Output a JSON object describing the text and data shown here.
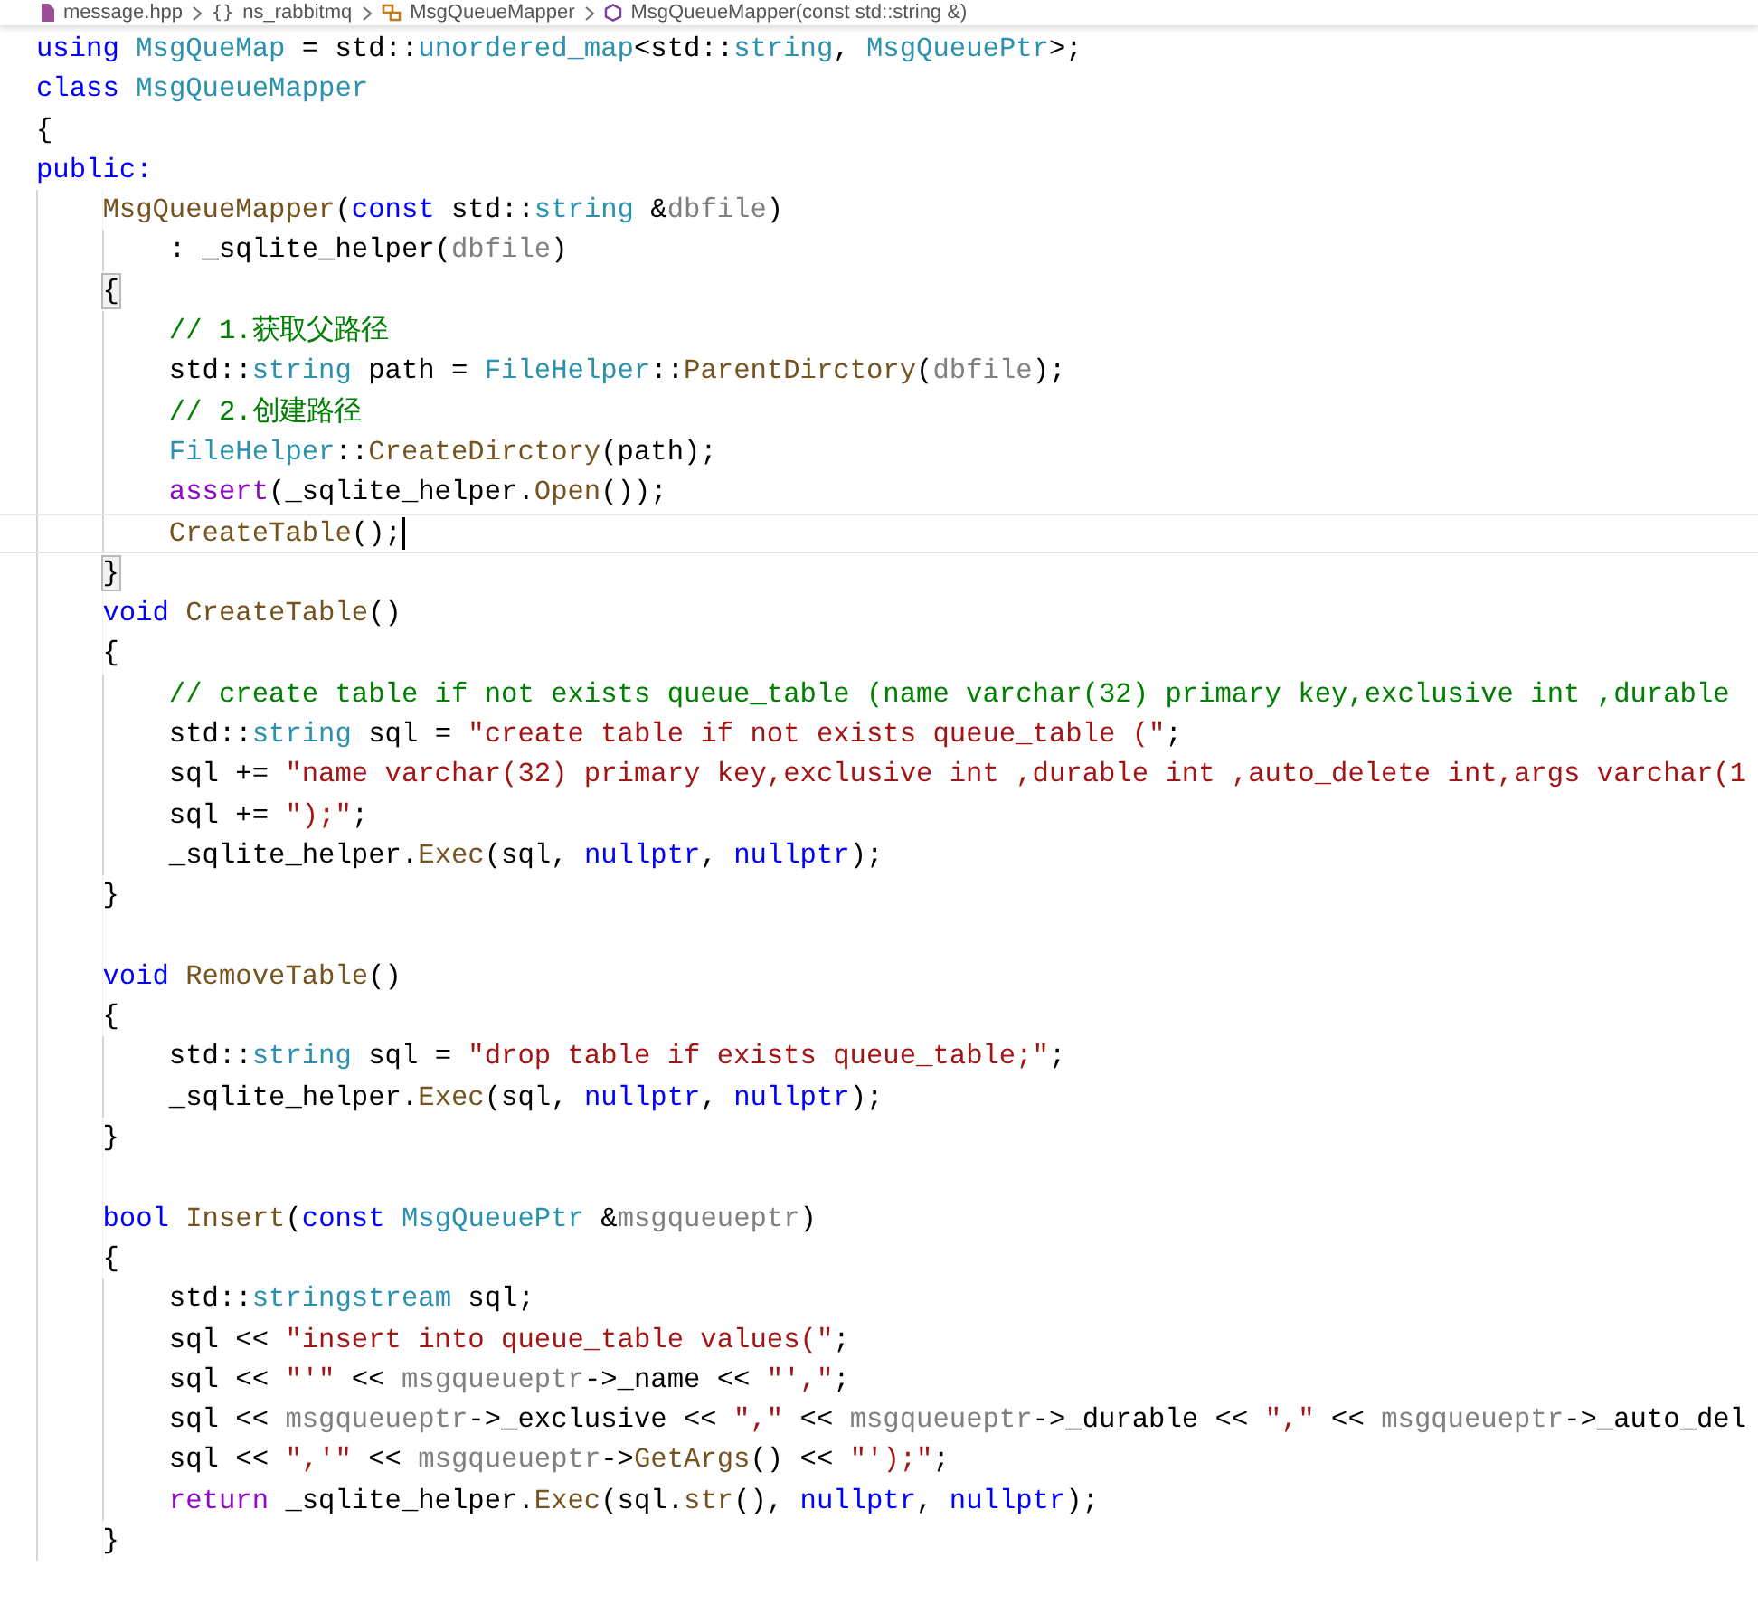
{
  "breadcrumb": [
    {
      "kind": "file",
      "label": "message.hpp"
    },
    {
      "kind": "namespace",
      "glyph": "{}",
      "label": "ns_rabbitmq"
    },
    {
      "kind": "class",
      "label": "MsgQueueMapper"
    },
    {
      "kind": "method",
      "label": "MsgQueueMapper(const std::string &)"
    }
  ],
  "editor": {
    "lines": [
      {
        "kind": "code",
        "tokens": [
          {
            "kind": "kw",
            "text": "using"
          },
          {
            "kind": "type",
            "text": " MsgQueMap"
          },
          {
            "kind": "p",
            "text": " = std::"
          },
          {
            "kind": "type",
            "text": "unordered_map"
          },
          {
            "kind": "p",
            "text": "<std::"
          },
          {
            "kind": "type",
            "text": "string"
          },
          {
            "kind": "p",
            "text": ","
          },
          {
            "kind": "type",
            "text": " MsgQueuePtr"
          },
          {
            "kind": "p",
            "text": ">;"
          }
        ]
      },
      {
        "kind": "code",
        "tokens": [
          {
            "kind": "kw",
            "text": "class"
          },
          {
            "kind": "type",
            "text": " MsgQueueMapper"
          }
        ]
      },
      {
        "kind": "code",
        "tokens": [
          {
            "kind": "p",
            "text": "{"
          }
        ]
      },
      {
        "kind": "code",
        "tokens": [
          {
            "kind": "kw",
            "text": "public:"
          }
        ]
      },
      {
        "kind": "code",
        "tokens": [
          {
            "kind": "fn",
            "text": "    MsgQueueMapper"
          },
          {
            "kind": "p",
            "text": "("
          },
          {
            "kind": "kw",
            "text": "const"
          },
          {
            "kind": "p",
            "text": " std::"
          },
          {
            "kind": "type",
            "text": "string"
          },
          {
            "kind": "p",
            "text": " &"
          },
          {
            "kind": "param",
            "text": "dbfile"
          },
          {
            "kind": "p",
            "text": ")"
          }
        ]
      },
      {
        "kind": "code",
        "tokens": [
          {
            "kind": "p",
            "text": "        : _sqlite_helper("
          },
          {
            "kind": "param",
            "text": "dbfile"
          },
          {
            "kind": "p",
            "text": ")"
          }
        ]
      },
      {
        "kind": "code",
        "tokens": [
          {
            "kind": "match",
            "text": "    {"
          }
        ]
      },
      {
        "kind": "code",
        "tokens": [
          {
            "kind": "cm",
            "text": "        // 1.获取父路径"
          }
        ]
      },
      {
        "kind": "code",
        "tokens": [
          {
            "kind": "p",
            "text": "        std::"
          },
          {
            "kind": "type",
            "text": "string"
          },
          {
            "kind": "p",
            "text": " path ="
          },
          {
            "kind": "type",
            "text": " FileHelper"
          },
          {
            "kind": "p",
            "text": "::"
          },
          {
            "kind": "fn",
            "text": "ParentDirctory"
          },
          {
            "kind": "p",
            "text": "("
          },
          {
            "kind": "param",
            "text": "dbfile"
          },
          {
            "kind": "p",
            "text": ");"
          }
        ]
      },
      {
        "kind": "code",
        "tokens": [
          {
            "kind": "cm",
            "text": "        // 2.创建路径"
          }
        ]
      },
      {
        "kind": "code",
        "tokens": [
          {
            "kind": "type",
            "text": "        FileHelper"
          },
          {
            "kind": "p",
            "text": "::"
          },
          {
            "kind": "fn",
            "text": "CreateDirctory"
          },
          {
            "kind": "p",
            "text": "(path);"
          }
        ]
      },
      {
        "kind": "code",
        "tokens": [
          {
            "kind": "macro",
            "text": "        assert"
          },
          {
            "kind": "p",
            "text": "(_sqlite_helper."
          },
          {
            "kind": "fn",
            "text": "Open"
          },
          {
            "kind": "p",
            "text": "());"
          }
        ]
      },
      {
        "kind": "code",
        "current": true,
        "tokens": [
          {
            "kind": "fn",
            "text": "        CreateTable"
          },
          {
            "kind": "p",
            "text": "();"
          }
        ]
      },
      {
        "kind": "code",
        "tokens": [
          {
            "kind": "match",
            "text": "    }"
          }
        ]
      },
      {
        "kind": "code",
        "tokens": [
          {
            "kind": "kw",
            "text": "    void"
          },
          {
            "kind": "fn",
            "text": " CreateTable"
          },
          {
            "kind": "p",
            "text": "()"
          }
        ]
      },
      {
        "kind": "code",
        "tokens": [
          {
            "kind": "p",
            "text": "    {"
          }
        ]
      },
      {
        "kind": "code",
        "tokens": [
          {
            "kind": "cm",
            "text": "        // create table if not exists queue_table (name varchar(32) primary key,exclusive int ,durable"
          }
        ]
      },
      {
        "kind": "code",
        "tokens": [
          {
            "kind": "p",
            "text": "        std::"
          },
          {
            "kind": "type",
            "text": "string"
          },
          {
            "kind": "p",
            "text": " sql ="
          },
          {
            "kind": "str",
            "text": " \"create table if not exists queue_table (\""
          },
          {
            "kind": "p",
            "text": ";"
          }
        ]
      },
      {
        "kind": "code",
        "tokens": [
          {
            "kind": "p",
            "text": "        sql +="
          },
          {
            "kind": "str",
            "text": " \"name varchar(32) primary key,exclusive int ,durable int ,auto_delete int,args varchar(1"
          }
        ]
      },
      {
        "kind": "code",
        "tokens": [
          {
            "kind": "p",
            "text": "        sql +="
          },
          {
            "kind": "str",
            "text": " \");\""
          },
          {
            "kind": "p",
            "text": ";"
          }
        ]
      },
      {
        "kind": "code",
        "tokens": [
          {
            "kind": "p",
            "text": "        _sqlite_helper."
          },
          {
            "kind": "fn",
            "text": "Exec"
          },
          {
            "kind": "p",
            "text": "(sql,"
          },
          {
            "kind": "kw",
            "text": " nullptr"
          },
          {
            "kind": "p",
            "text": ","
          },
          {
            "kind": "kw",
            "text": " nullptr"
          },
          {
            "kind": "p",
            "text": ");"
          }
        ]
      },
      {
        "kind": "code",
        "tokens": [
          {
            "kind": "p",
            "text": "    }"
          }
        ]
      },
      {
        "kind": "blank"
      },
      {
        "kind": "code",
        "tokens": [
          {
            "kind": "kw",
            "text": "    void"
          },
          {
            "kind": "fn",
            "text": " RemoveTable"
          },
          {
            "kind": "p",
            "text": "()"
          }
        ]
      },
      {
        "kind": "code",
        "tokens": [
          {
            "kind": "p",
            "text": "    {"
          }
        ]
      },
      {
        "kind": "code",
        "tokens": [
          {
            "kind": "p",
            "text": "        std::"
          },
          {
            "kind": "type",
            "text": "string"
          },
          {
            "kind": "p",
            "text": " sql ="
          },
          {
            "kind": "str",
            "text": " \"drop table if exists queue_table;\""
          },
          {
            "kind": "p",
            "text": ";"
          }
        ]
      },
      {
        "kind": "code",
        "tokens": [
          {
            "kind": "p",
            "text": "        _sqlite_helper."
          },
          {
            "kind": "fn",
            "text": "Exec"
          },
          {
            "kind": "p",
            "text": "(sql,"
          },
          {
            "kind": "kw",
            "text": " nullptr"
          },
          {
            "kind": "p",
            "text": ","
          },
          {
            "kind": "kw",
            "text": " nullptr"
          },
          {
            "kind": "p",
            "text": ");"
          }
        ]
      },
      {
        "kind": "code",
        "tokens": [
          {
            "kind": "p",
            "text": "    }"
          }
        ]
      },
      {
        "kind": "blank"
      },
      {
        "kind": "code",
        "tokens": [
          {
            "kind": "kw",
            "text": "    bool"
          },
          {
            "kind": "fn",
            "text": " Insert"
          },
          {
            "kind": "p",
            "text": "("
          },
          {
            "kind": "kw",
            "text": "const"
          },
          {
            "kind": "type",
            "text": " MsgQueuePtr"
          },
          {
            "kind": "p",
            "text": " &"
          },
          {
            "kind": "param",
            "text": "msgqueueptr"
          },
          {
            "kind": "p",
            "text": ")"
          }
        ]
      },
      {
        "kind": "code",
        "tokens": [
          {
            "kind": "p",
            "text": "    {"
          }
        ]
      },
      {
        "kind": "code",
        "tokens": [
          {
            "kind": "p",
            "text": "        std::"
          },
          {
            "kind": "type",
            "text": "stringstream"
          },
          {
            "kind": "p",
            "text": " sql;"
          }
        ]
      },
      {
        "kind": "code",
        "tokens": [
          {
            "kind": "p",
            "text": "        sql <<"
          },
          {
            "kind": "str",
            "text": " \"insert into queue_table values(\""
          },
          {
            "kind": "p",
            "text": ";"
          }
        ]
      },
      {
        "kind": "code",
        "tokens": [
          {
            "kind": "p",
            "text": "        sql <<"
          },
          {
            "kind": "str",
            "text": " \"'\""
          },
          {
            "kind": "p",
            "text": " <<"
          },
          {
            "kind": "param",
            "text": " msgqueueptr"
          },
          {
            "kind": "p",
            "text": "->_name <<"
          },
          {
            "kind": "str",
            "text": " \"',\""
          },
          {
            "kind": "p",
            "text": ";"
          }
        ]
      },
      {
        "kind": "code",
        "tokens": [
          {
            "kind": "p",
            "text": "        sql <<"
          },
          {
            "kind": "param",
            "text": " msgqueueptr"
          },
          {
            "kind": "p",
            "text": "->_exclusive <<"
          },
          {
            "kind": "str",
            "text": " \",\""
          },
          {
            "kind": "p",
            "text": " <<"
          },
          {
            "kind": "param",
            "text": " msgqueueptr"
          },
          {
            "kind": "p",
            "text": "->_durable <<"
          },
          {
            "kind": "str",
            "text": " \",\""
          },
          {
            "kind": "p",
            "text": " <<"
          },
          {
            "kind": "param",
            "text": " msgqueueptr"
          },
          {
            "kind": "p",
            "text": "->_auto_del"
          }
        ]
      },
      {
        "kind": "code",
        "tokens": [
          {
            "kind": "p",
            "text": "        sql <<"
          },
          {
            "kind": "str",
            "text": " \",'\""
          },
          {
            "kind": "p",
            "text": " <<"
          },
          {
            "kind": "param",
            "text": " msgqueueptr"
          },
          {
            "kind": "p",
            "text": "->"
          },
          {
            "kind": "fn",
            "text": "GetArgs"
          },
          {
            "kind": "p",
            "text": "() <<"
          },
          {
            "kind": "str",
            "text": " \"');\""
          },
          {
            "kind": "p",
            "text": ";"
          }
        ]
      },
      {
        "kind": "code",
        "tokens": [
          {
            "kind": "ctl",
            "text": "        return"
          },
          {
            "kind": "p",
            "text": " _sqlite_helper."
          },
          {
            "kind": "fn",
            "text": "Exec"
          },
          {
            "kind": "p",
            "text": "(sql."
          },
          {
            "kind": "fn",
            "text": "str"
          },
          {
            "kind": "p",
            "text": "(),"
          },
          {
            "kind": "kw",
            "text": " nullptr"
          },
          {
            "kind": "p",
            "text": ","
          },
          {
            "kind": "kw",
            "text": " nullptr"
          },
          {
            "kind": "p",
            "text": ");"
          }
        ]
      },
      {
        "kind": "code",
        "tokens": [
          {
            "kind": "p",
            "text": "    }"
          }
        ]
      }
    ]
  }
}
